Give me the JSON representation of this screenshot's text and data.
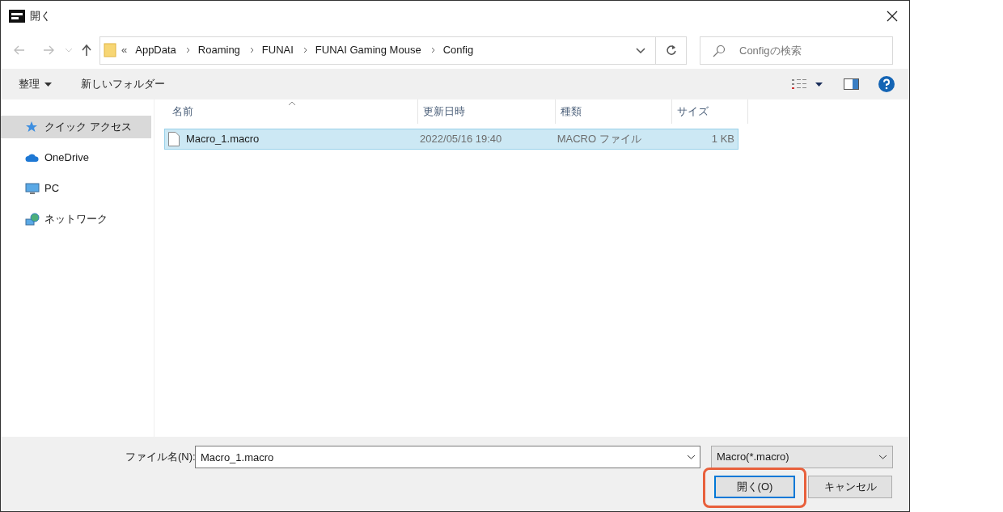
{
  "window": {
    "title": "開く"
  },
  "address": {
    "overflow": "«",
    "crumbs": [
      "AppData",
      "Roaming",
      "FUNAI",
      "FUNAI Gaming Mouse",
      "Config"
    ]
  },
  "search": {
    "placeholder": "Configの検索"
  },
  "toolbar": {
    "organize": "整理",
    "new_folder": "新しいフォルダー"
  },
  "sidebar": {
    "items": [
      {
        "label": "クイック アクセス",
        "kind": "star",
        "selected": true
      },
      {
        "label": "OneDrive",
        "kind": "cloud",
        "selected": false
      },
      {
        "label": "PC",
        "kind": "pc",
        "selected": false
      },
      {
        "label": "ネットワーク",
        "kind": "network",
        "selected": false
      }
    ]
  },
  "table": {
    "columns": [
      "名前",
      "更新日時",
      "種類",
      "サイズ"
    ],
    "rows": [
      {
        "name": "Macro_1.macro",
        "date": "2022/05/16 19:40",
        "type": "MACRO ファイル",
        "size": "1 KB",
        "selected": true
      }
    ]
  },
  "footer": {
    "filename_label": "ファイル名(N):",
    "filename": "Macro_1.macro",
    "filter": "Macro(*.macro)",
    "open": "開く(O)",
    "cancel": "キャンセル",
    "open_highlighted": true
  }
}
